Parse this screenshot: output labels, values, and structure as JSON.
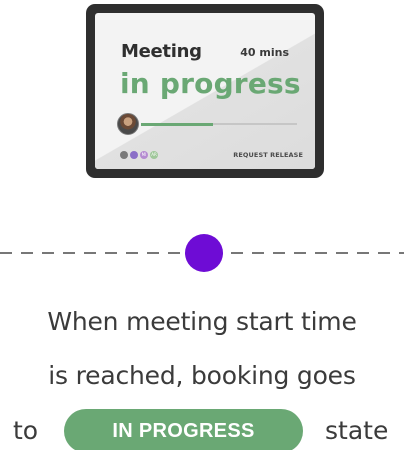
{
  "device_card": {
    "title": "Meeting",
    "duration": "40 mins",
    "status": "in progress",
    "progress_fraction": 0.46,
    "attendees": [
      {
        "initials": "",
        "color": "#7a7a7a"
      },
      {
        "initials": "",
        "color": "#8b6fc7"
      },
      {
        "initials": "MI",
        "color": "#b58bd1"
      },
      {
        "initials": "AR",
        "color": "#9fc79a"
      }
    ],
    "request_release_label": "REQUEST RELEASE"
  },
  "caption": {
    "line1": "When meeting start time",
    "line2": "is reached, booking goes",
    "line3_prefix": "to",
    "badge": "IN PROGRESS",
    "line3_suffix": "state"
  },
  "colors": {
    "accent_green": "#6aa874",
    "timeline_dot": "#6e0cd5",
    "device_frame": "#2e2e2e"
  }
}
